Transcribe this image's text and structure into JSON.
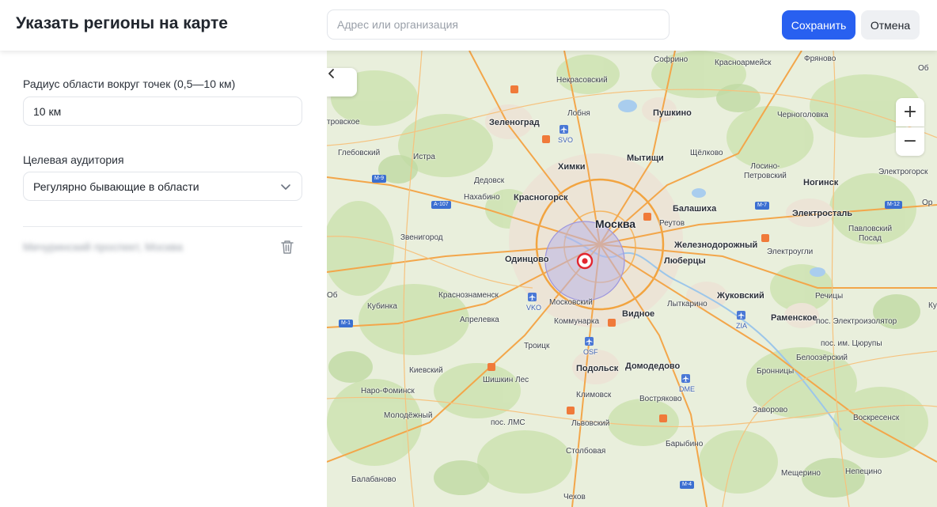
{
  "header": {
    "title": "Указать регионы на карте",
    "search_placeholder": "Адрес или организация",
    "save_label": "Сохранить",
    "cancel_label": "Отмена"
  },
  "panel": {
    "radius_label": "Радиус области вокруг точек (0,5—10 км)",
    "radius_value": "10 км",
    "audience_label": "Целевая аудитория",
    "audience_value": "Регулярно бывающие в области",
    "region_name": "Мичуринский проспект, Москва"
  },
  "map": {
    "labels": {
      "sofrino": "Софрино",
      "krasnoarmeysk": "Красноармейск",
      "fryanovo": "Фряново",
      "nekrasovsky": "Некрасовский",
      "lobnya": "Лобня",
      "pushkino": "Пушкино",
      "zelenograd": "Зеленоград",
      "chernogolovka": "Черноголовка",
      "trovskoe": "тровское",
      "glebovsky": "Глебовский",
      "istra": "Истра",
      "khimki": "Химки",
      "mytishchi": "Мытищи",
      "shchelkovo": "Щёлково",
      "losino": "Лосино-\nПетровский",
      "elektrogorsk": "Электрогорск",
      "dedovsk": "Дедовск",
      "nakhabino": "Нахабино",
      "krasnogorsk": "Красногорск",
      "noginsk": "Ногинск",
      "balashikha": "Балашиха",
      "elektrostal": "Электросталь",
      "moskva": "Москва",
      "reutov": "Реутов",
      "zvenigorod": "Звенигород",
      "pavlovsky": "Павловский\nПосад",
      "zheleznodorozhny": "Железнодорожный",
      "elektrougli": "Электроугли",
      "odintsovo": "Одинцово",
      "lyubertsy": "Люберцы",
      "kubinka": "Кубинка",
      "krasnoznamensk": "Краснознаменск",
      "moskovsky": "Московский",
      "lytkarino": "Лыткарино",
      "zhukovsky": "Жуковский",
      "rechitsy": "Речицы",
      "aprelevka": "Апрелевка",
      "kommunarka": "Коммунарка",
      "vidnoe": "Видное",
      "ramenskoe": "Раменское",
      "elektroizolyator": "пос. Электроизолятор",
      "troitsk": "Троицк",
      "im_tsyurupy": "пос. им. Цюрупы",
      "beloozersky": "Белоозёрский",
      "kievsky": "Киевский",
      "podolsk": "Подольск",
      "domodedovo": "Домодедово",
      "bronnitsy": "Бронницы",
      "naro_fominsk": "Наро-Фоминск",
      "shishkin_les": "Шишкин Лес",
      "klimovsk": "Климовск",
      "vostryakovo": "Востряково",
      "zavorovo": "Заворово",
      "molodezhny": "Молодёжный",
      "pos_lms": "пос. ЛМС",
      "lvovsky": "Львовский",
      "voskresensk": "Воскресенск",
      "barybino": "Барыбино",
      "stolbovaya": "Столбовая",
      "balabanovo": "Балабаново",
      "meshcherino": "Мещерино",
      "nepetsino": "Непецино",
      "chekhov": "Чехов",
      "ob": "Об",
      "or": "Ор",
      "kur": "Кур"
    },
    "airports": {
      "svo": "SVO",
      "vko": "VKO",
      "osf": "OSF",
      "dme": "DME",
      "zia": "ZIA"
    },
    "roads": {
      "m9": "М-9",
      "a107": "А-107",
      "m7": "М-7",
      "m12": "М-12",
      "m1": "М-1",
      "m4": "М-4"
    },
    "zoom_in": "+",
    "zoom_out": "−",
    "colors": {
      "circle_fill": "#b9b4e8",
      "marker": "#e2262f",
      "primary": "#2860f0"
    }
  }
}
